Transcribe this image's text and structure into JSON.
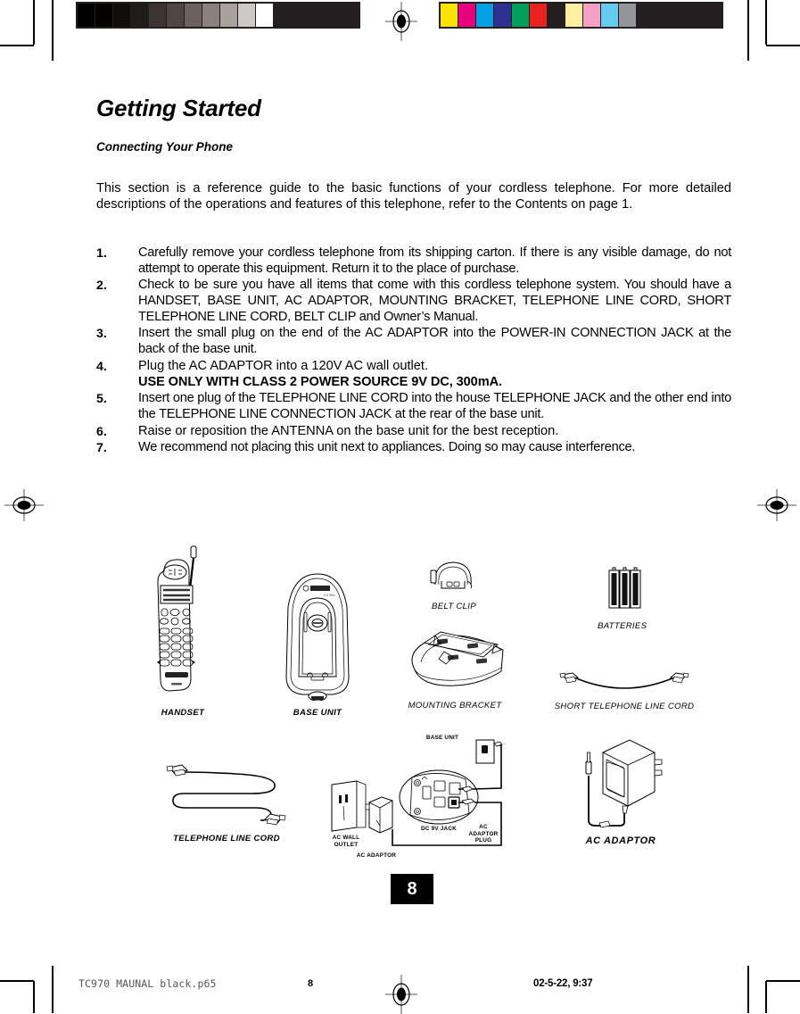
{
  "document": {
    "title": "Getting Started",
    "subtitle": "Connecting Your Phone",
    "intro": "This section is a reference guide to the basic functions of your cordless telephone. For more detailed descriptions of the operations and features of this telephone, refer to the Contents on page 1.",
    "page_number": "8"
  },
  "steps": [
    {
      "num": "1.",
      "text": "Carefully remove your cordless telephone from its shipping carton. If there is any visible damage, do not attempt to operate this equipment. Return it to the place of purchase.",
      "emphasis": ""
    },
    {
      "num": "2.",
      "text": "Check to be sure you have all items that come with this cordless telephone system. You should have a HANDSET, BASE UNIT, AC ADAPTOR, MOUNTING BRACKET, TELEPHONE LINE CORD, SHORT TELEPHONE LINE CORD, BELT CLIP and Owner’s Manual.",
      "emphasis": ""
    },
    {
      "num": "3.",
      "text": "Insert  the small plug on the end of the AC ADAPTOR into the POWER-IN CONNECTION JACK at the back of the base unit.",
      "emphasis": ""
    },
    {
      "num": "4.",
      "text": "Plug the AC ADAPTOR into  a 120V AC wall outlet.",
      "emphasis": "USE ONLY WITH CLASS 2 POWER SOURCE 9V DC, 300mA."
    },
    {
      "num": "5.",
      "text": "Insert one plug of the TELEPHONE LINE CORD into the house TELEPHONE JACK and the other end into the TELEPHONE LINE CONNECTION JACK  at the rear of the base unit.",
      "emphasis": ""
    },
    {
      "num": "6.",
      "text": "Raise or reposition the ANTENNA on the base unit for the best reception.",
      "emphasis": ""
    },
    {
      "num": "7.",
      "text": "We recommend not placing this unit next to appliances. Doing so may cause interference.",
      "emphasis": ""
    }
  ],
  "figures": {
    "handset": "HANDSET",
    "base_unit": "BASE UNIT",
    "belt_clip": "BELT CLIP",
    "mounting_bracket": "MOUNTING BRACKET",
    "batteries": "BATTERIES",
    "short_line_cord": "SHORT TELEPHONE LINE CORD",
    "telephone_line_cord": "TELEPHONE LINE CORD",
    "ac_adaptor": "AC ADAPTOR"
  },
  "wiring_diagram": {
    "base_unit": "BASE UNIT",
    "ac_wall_outlet": "AC WALL\nOUTLET",
    "ac_adaptor": "AC ADAPTOR",
    "dc_9v_jack": "DC 9V JACK",
    "ac_adaptor_plug": "AC\nADAPTOR\nPLUG"
  },
  "footer": {
    "filename": "TC970 MAUNAL black.p65",
    "page": "8",
    "timestamp": "02-5-22, 9:37"
  },
  "calibration": {
    "grey_swatches": [
      "#000000",
      "#040000",
      "#110d0b",
      "#201c1a",
      "#3b3431",
      "#4e4643",
      "#6b625f",
      "#8a817e",
      "#a8a19e",
      "#cdc9c6",
      "#ffffff"
    ],
    "color_swatches": [
      "#fae300",
      "#e6007e",
      "#00a0e2",
      "#2e3191",
      "#00a05a",
      "#e8231f",
      "#231f20",
      "#faf0a0",
      "#f2a1c4",
      "#66cdf2",
      "#939598"
    ]
  }
}
